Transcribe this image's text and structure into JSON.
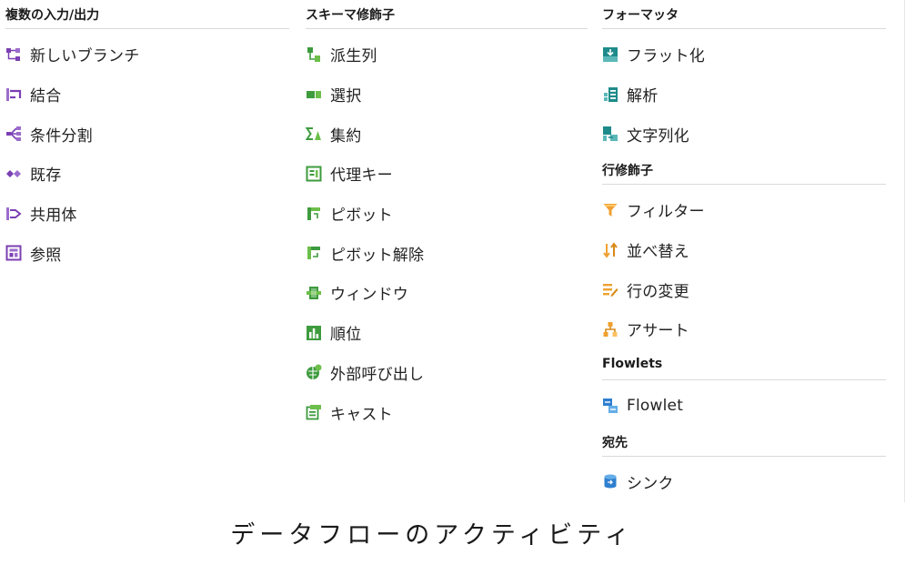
{
  "colors": {
    "purple": "#7b3fb3",
    "green": "#3e9b3e",
    "teal": "#1f8a8a",
    "orange": "#f0a030",
    "blue": "#2f7fd0",
    "header_rule": "#d9d9d9"
  },
  "columns": [
    {
      "sections": [
        {
          "header": "複数の入力/出力",
          "items": [
            {
              "label": "新しいブランチ",
              "icon": "new-branch-icon"
            },
            {
              "label": "結合",
              "icon": "join-icon"
            },
            {
              "label": "条件分割",
              "icon": "conditional-split-icon"
            },
            {
              "label": "既存",
              "icon": "exists-icon"
            },
            {
              "label": "共用体",
              "icon": "union-icon"
            },
            {
              "label": "参照",
              "icon": "lookup-icon"
            }
          ]
        }
      ]
    },
    {
      "sections": [
        {
          "header": "スキーマ修飾子",
          "items": [
            {
              "label": "派生列",
              "icon": "derived-column-icon"
            },
            {
              "label": "選択",
              "icon": "select-icon"
            },
            {
              "label": "集約",
              "icon": "aggregate-icon"
            },
            {
              "label": "代理キー",
              "icon": "surrogate-key-icon"
            },
            {
              "label": "ピボット",
              "icon": "pivot-icon"
            },
            {
              "label": "ピボット解除",
              "icon": "unpivot-icon"
            },
            {
              "label": "ウィンドウ",
              "icon": "window-icon"
            },
            {
              "label": "順位",
              "icon": "rank-icon"
            },
            {
              "label": "外部呼び出し",
              "icon": "external-call-icon"
            },
            {
              "label": "キャスト",
              "icon": "cast-icon"
            }
          ]
        }
      ]
    },
    {
      "sections": [
        {
          "header": "フォーマッタ",
          "items": [
            {
              "label": "フラット化",
              "icon": "flatten-icon"
            },
            {
              "label": "解析",
              "icon": "parse-icon"
            },
            {
              "label": "文字列化",
              "icon": "stringify-icon"
            }
          ]
        },
        {
          "header": "行修飾子",
          "items": [
            {
              "label": "フィルター",
              "icon": "filter-icon"
            },
            {
              "label": "並べ替え",
              "icon": "sort-icon"
            },
            {
              "label": "行の変更",
              "icon": "alter-row-icon"
            },
            {
              "label": "アサート",
              "icon": "assert-icon"
            }
          ]
        },
        {
          "header": "Flowlets",
          "items": [
            {
              "label": "Flowlet",
              "icon": "flowlet-icon"
            }
          ]
        },
        {
          "header": "宛先",
          "items": [
            {
              "label": "シンク",
              "icon": "sink-icon"
            }
          ]
        }
      ]
    }
  ],
  "caption": "データフローのアクティビティ"
}
